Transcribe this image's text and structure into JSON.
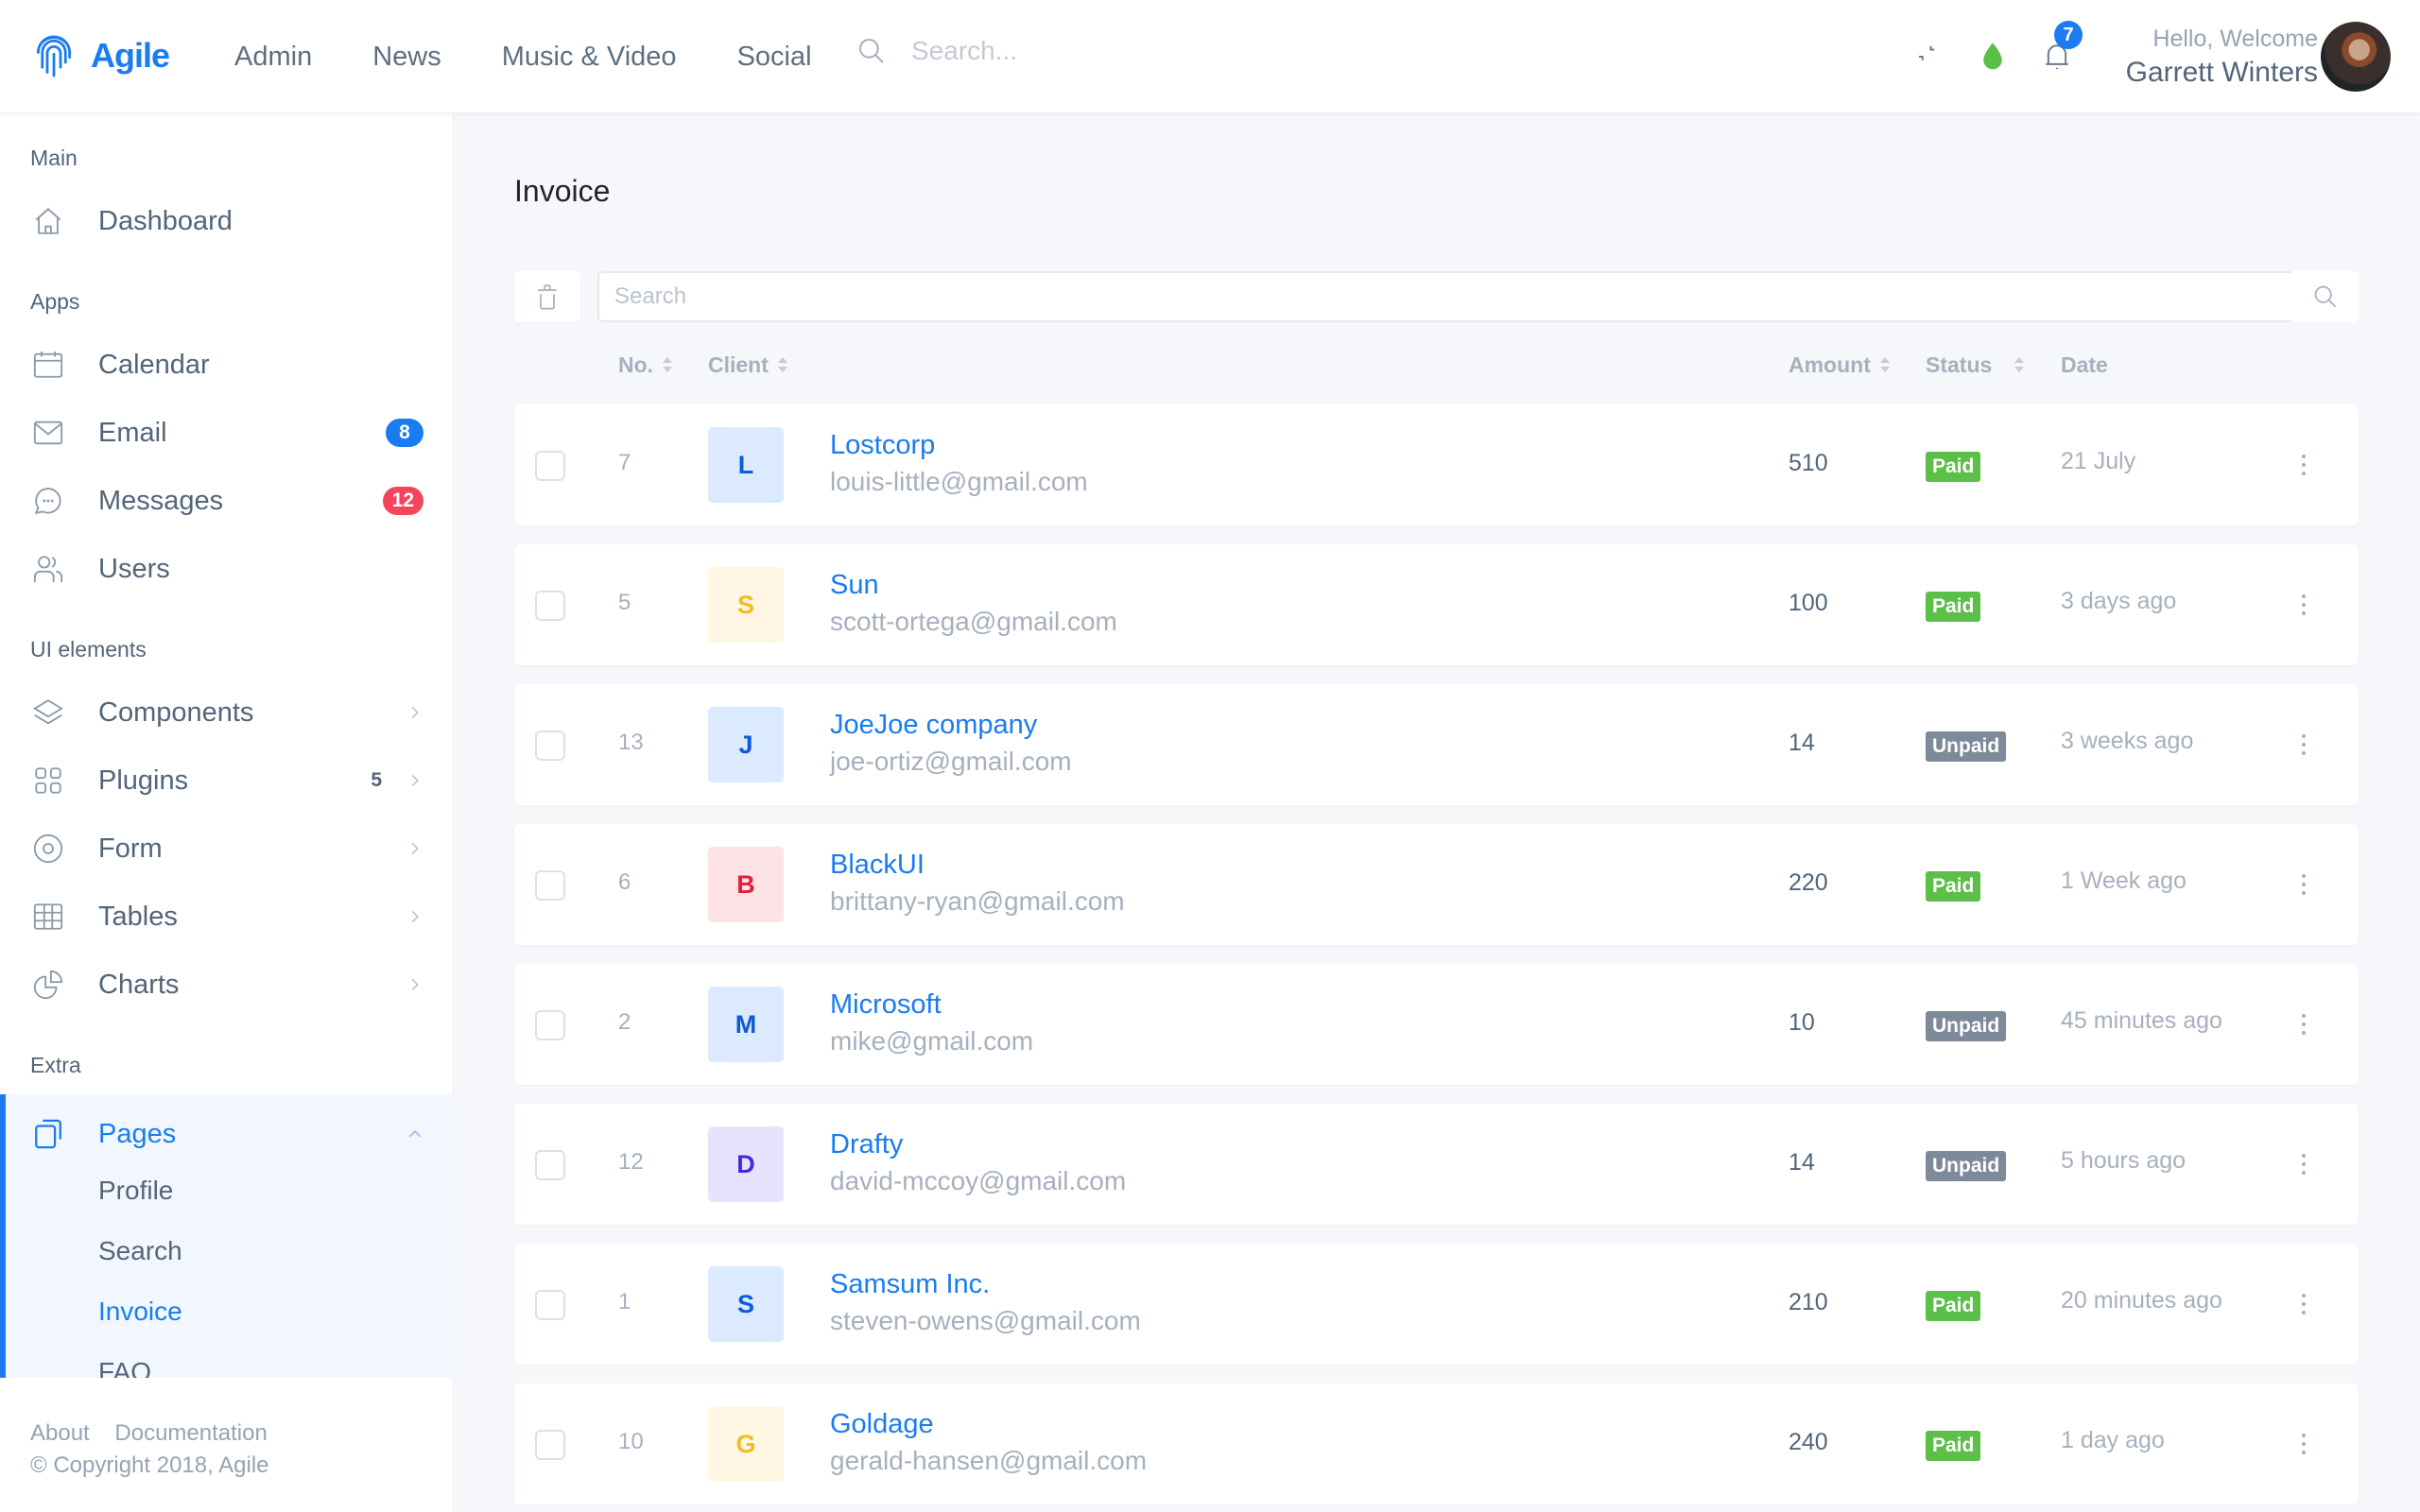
{
  "app": {
    "brand": "Agile",
    "accent": "#1a7cf0"
  },
  "header": {
    "nav": [
      "Admin",
      "News",
      "Music & Video",
      "Social"
    ],
    "search_placeholder": "Search...",
    "notifications_count": "7",
    "greeting": "Hello, Welcome",
    "user_name": "Garrett Winters",
    "icons": [
      "fullscreen-icon",
      "theme-drop-icon",
      "bell-icon"
    ]
  },
  "sidebar": {
    "sections": {
      "main": "Main",
      "apps": "Apps",
      "ui": "UI elements",
      "extra": "Extra"
    },
    "items": [
      {
        "label": "Dashboard",
        "icon": "home-icon"
      },
      {
        "label": "Calendar",
        "icon": "calendar-icon"
      },
      {
        "label": "Email",
        "icon": "mail-icon",
        "badge": "8",
        "badge_color": "#1a7cf0"
      },
      {
        "label": "Messages",
        "icon": "chat-icon",
        "badge": "12",
        "badge_color": "#f5455c"
      },
      {
        "label": "Users",
        "icon": "users-icon"
      },
      {
        "label": "Components",
        "icon": "layers-icon"
      },
      {
        "label": "Plugins",
        "icon": "grid-icon",
        "count": "5"
      },
      {
        "label": "Form",
        "icon": "target-icon"
      },
      {
        "label": "Tables",
        "icon": "table-icon"
      },
      {
        "label": "Charts",
        "icon": "pie-chart-icon"
      },
      {
        "label": "Pages",
        "icon": "pages-icon",
        "active": true
      }
    ],
    "pages_sub": [
      "Profile",
      "Search",
      "Invoice",
      "FAQ"
    ],
    "active_sub": "Invoice",
    "footer": {
      "links": [
        "About",
        "Documentation"
      ],
      "copyright": "© Copyright 2018, Agile"
    }
  },
  "main": {
    "title": "Invoice",
    "search_placeholder": "Search",
    "columns": [
      "No.",
      "Client",
      "Amount",
      "Status",
      "Date"
    ],
    "status_colors": {
      "Paid": "#5bbf48",
      "Unpaid": "#7d8a99"
    },
    "rows": [
      {
        "no": "7",
        "initial": "L",
        "avatar_bg": "#dbeafe",
        "avatar_fg": "#0a5bd6",
        "client": "Lostcorp",
        "email": "louis-little@gmail.com",
        "amount": "510",
        "status": "Paid",
        "date": "21 July"
      },
      {
        "no": "5",
        "initial": "S",
        "avatar_bg": "#fff7e3",
        "avatar_fg": "#f7b924",
        "client": "Sun",
        "email": "scott-ortega@gmail.com",
        "amount": "100",
        "status": "Paid",
        "date": "3 days ago"
      },
      {
        "no": "13",
        "initial": "J",
        "avatar_bg": "#dbeafe",
        "avatar_fg": "#0a5bd6",
        "client": "JoeJoe company",
        "email": "joe-ortiz@gmail.com",
        "amount": "14",
        "status": "Unpaid",
        "date": "3 weeks ago"
      },
      {
        "no": "6",
        "initial": "B",
        "avatar_bg": "#fde2e6",
        "avatar_fg": "#ea1b36",
        "client": "BlackUI",
        "email": "brittany-ryan@gmail.com",
        "amount": "220",
        "status": "Paid",
        "date": "1 Week ago"
      },
      {
        "no": "2",
        "initial": "M",
        "avatar_bg": "#dbeafe",
        "avatar_fg": "#0a5bd6",
        "client": "Microsoft",
        "email": "mike@gmail.com",
        "amount": "10",
        "status": "Unpaid",
        "date": "45 minutes ago"
      },
      {
        "no": "12",
        "initial": "D",
        "avatar_bg": "#e8e3fd",
        "avatar_fg": "#4a25e8",
        "client": "Drafty",
        "email": "david-mccoy@gmail.com",
        "amount": "14",
        "status": "Unpaid",
        "date": "5 hours ago"
      },
      {
        "no": "1",
        "initial": "S",
        "avatar_bg": "#dbeafe",
        "avatar_fg": "#0a5bd6",
        "client": "Samsum Inc.",
        "email": "steven-owens@gmail.com",
        "amount": "210",
        "status": "Paid",
        "date": "20 minutes ago"
      },
      {
        "no": "10",
        "initial": "G",
        "avatar_bg": "#fff7e3",
        "avatar_fg": "#f7b924",
        "client": "Goldage",
        "email": "gerald-hansen@gmail.com",
        "amount": "240",
        "status": "Paid",
        "date": "1 day ago"
      }
    ]
  }
}
